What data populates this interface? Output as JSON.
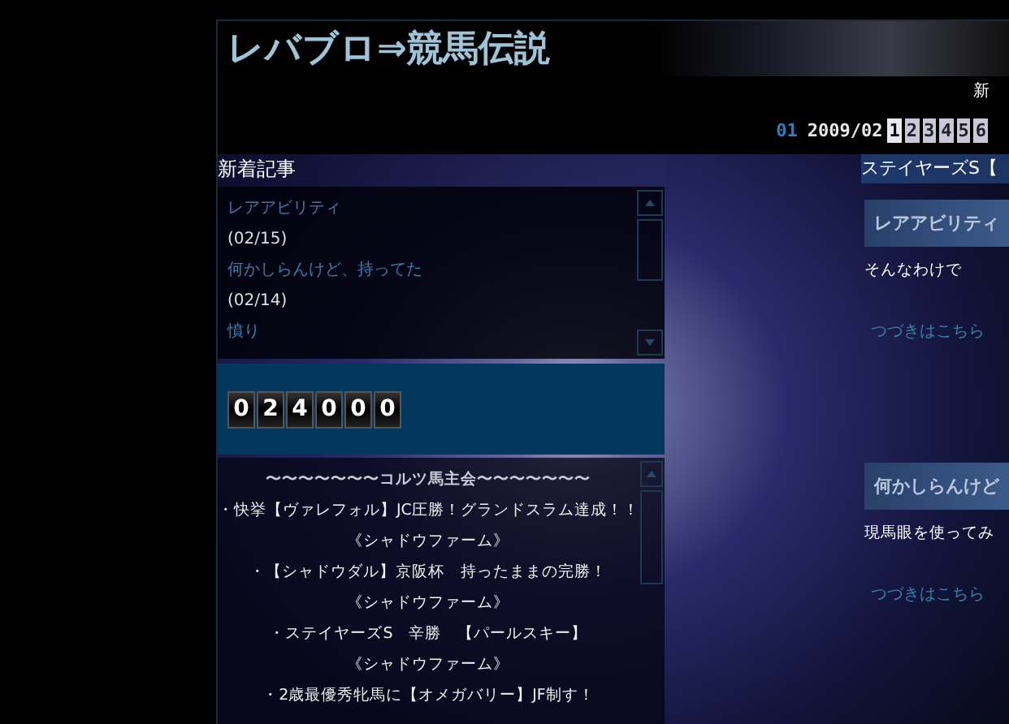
{
  "header": {
    "title": "レバブロ⇒競馬伝説",
    "nav_text": "新"
  },
  "calendar": {
    "prev": "01",
    "month": "2009/02",
    "days": [
      {
        "label": "1",
        "selected": true
      },
      {
        "label": "2",
        "selected": false
      },
      {
        "label": "3",
        "selected": false
      },
      {
        "label": "4",
        "selected": false
      },
      {
        "label": "5",
        "selected": false
      },
      {
        "label": "6",
        "selected": false
      }
    ]
  },
  "recent": {
    "heading": "新着記事",
    "items": [
      {
        "kind": "link",
        "text": "レアアビリティ"
      },
      {
        "kind": "date",
        "text": "(02/15)"
      },
      {
        "kind": "link",
        "text": "何かしらんけど、持ってた"
      },
      {
        "kind": "date",
        "text": "(02/14)"
      },
      {
        "kind": "link",
        "text": "憤り"
      }
    ]
  },
  "counter": {
    "digits": [
      "0",
      "2",
      "4",
      "0",
      "0",
      "0"
    ]
  },
  "club": {
    "heading": "〜〜〜〜〜〜〜コルツ馬主会〜〜〜〜〜〜〜",
    "lines": [
      "・快挙【ヴァレフォル】JC圧勝！グランドスラム達成！！",
      "《シャドウファーム》",
      "・【シャドウダル】京阪杯　持ったままの完勝！",
      "《シャドウファーム》",
      "・ステイヤーズS　辛勝　【パールスキー】",
      "《シャドウファーム》",
      "・2歳最優秀牝馬に【オメガバリー】JF制す！"
    ]
  },
  "main": {
    "ticker": "ステイヤーズS【",
    "posts": [
      {
        "title": "レアアビリティ",
        "excerpt": "そんなわけで",
        "more": "つづきはこちら"
      },
      {
        "title": "何かしらんけど",
        "excerpt": "現馬眼を使ってみ",
        "more": "つづきはこちら"
      }
    ]
  }
}
